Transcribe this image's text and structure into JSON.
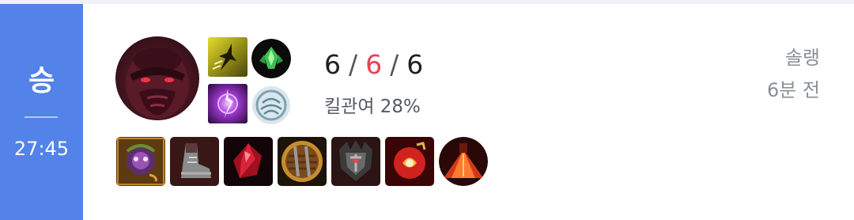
{
  "match": {
    "result": "승",
    "duration": "27:45",
    "queue": "솔랭",
    "time_ago": "6분 전",
    "colors": {
      "win": "#5383e8",
      "deaths": "#e84057"
    }
  },
  "champion": {
    "icon": "champion-portrait-icon"
  },
  "summoner_spells": [
    {
      "icon": "ghost-spell-icon"
    },
    {
      "icon": "ignite-spell-icon"
    }
  ],
  "runes": [
    {
      "icon": "keystone-rune-icon"
    },
    {
      "icon": "secondary-rune-tree-icon"
    }
  ],
  "kda": {
    "kills": "6",
    "deaths": "6",
    "assists": "6",
    "separator": "/"
  },
  "kill_participation": "킬관여 28%",
  "items": [
    {
      "icon": "item-1-icon"
    },
    {
      "icon": "item-2-boots-icon"
    },
    {
      "icon": "item-3-icon"
    },
    {
      "icon": "item-4-shield-icon"
    },
    {
      "icon": "item-5-icon"
    },
    {
      "icon": "item-6-icon"
    },
    {
      "icon": "trinket-ward-icon"
    }
  ]
}
